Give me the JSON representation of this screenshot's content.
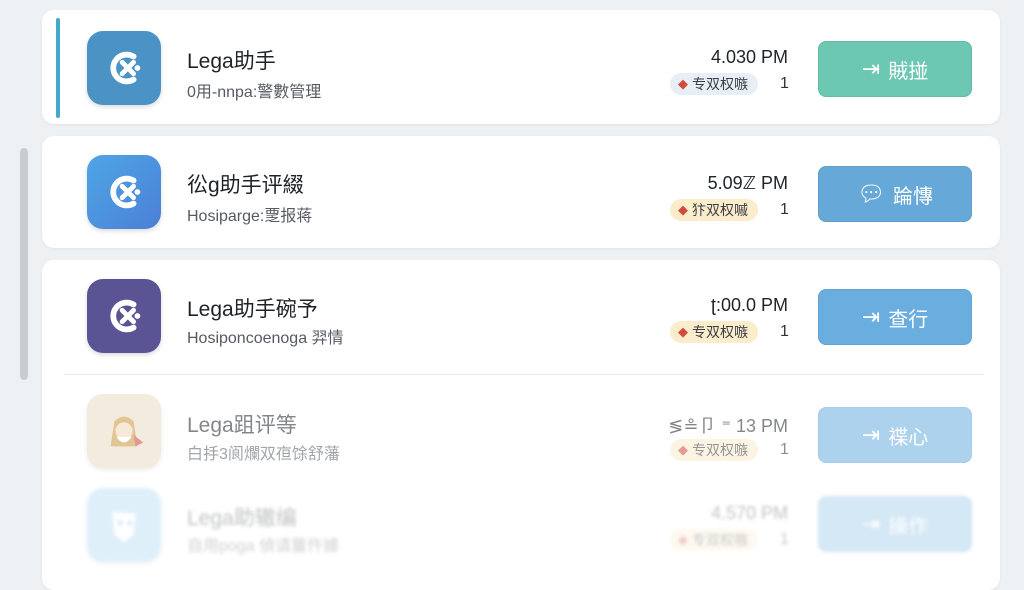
{
  "rows": [
    {
      "title": "Lega助手",
      "subtitle": "0用-nnpa:警數管理",
      "time": "4.030 PM",
      "badge": "专双权嗾",
      "count": "1",
      "button": "賊掽",
      "button_icon": "exit-arrow-icon",
      "app_icon": "lega-logo-icon",
      "colors": {
        "icon_bg": "#4a93c4",
        "button_bg": "#6cc7b3",
        "badge_bg": "#e8eef6"
      }
    },
    {
      "title": "彸g助手评綴",
      "subtitle": "Hosiparge:覂报蒋",
      "time": "5.09ℤ PM",
      "badge": "犿双权嘁",
      "count": "1",
      "button": "踚慱",
      "button_icon": "chat-bubble-icon",
      "app_icon": "lega-logo-icon",
      "colors": {
        "icon_bg": "#4b8fdc",
        "button_bg": "#66a9d8",
        "badge_bg": "#fbeccb"
      }
    },
    {
      "title": "Lega助手碗予",
      "subtitle": "Hosiponcoenoga 羿情",
      "time": "ʈ:00.0 PM",
      "badge": "专双权嗾",
      "count": "1",
      "button": "查行",
      "button_icon": "exit-arrow-icon",
      "app_icon": "lega-logo-icon",
      "colors": {
        "icon_bg": "#5a5494",
        "button_bg": "#6aaee0",
        "badge_bg": "#fbeccb"
      }
    },
    {
      "title": "Lega跙评等",
      "subtitle": "白抙3阆爛双亱馀舒藩",
      "time": "≶≗卩 ⁼ 13 PM",
      "badge": "专双权嗾",
      "count": "1",
      "button": "褋心",
      "button_icon": "exit-arrow-icon",
      "app_icon": "character-avatar-icon",
      "colors": {
        "icon_bg": "#e9dcc4",
        "button_bg": "#6aaee0",
        "badge_bg": "#fbeccb"
      }
    },
    {
      "title": "Lega助辙编",
      "subtitle": "自用poga 偵请薑忤據",
      "time": "4.570 PM",
      "badge": "专双权嗾",
      "count": "1",
      "button": "操作",
      "button_icon": "exit-arrow-icon",
      "app_icon": "mask-avatar-icon",
      "colors": {
        "icon_bg": "#8ec7ee",
        "button_bg": "#6aaee0",
        "badge_bg": "#fbeccb"
      }
    }
  ]
}
